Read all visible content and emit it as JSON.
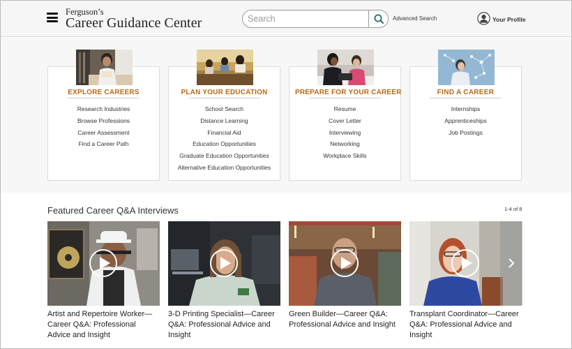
{
  "header": {
    "brand_top": "Ferguson’s",
    "brand_main": "Career Guidance Center",
    "search_placeholder": "Search",
    "advanced_search": "Advanced Search",
    "profile_label": "Your Profile"
  },
  "categories": [
    {
      "title": "EXPLORE CAREERS",
      "links": [
        "Research Industries",
        "Browse Professions",
        "Career Assessment",
        "Find a Career Path"
      ]
    },
    {
      "title": "PLAN YOUR EDUCATION",
      "links": [
        "School Search",
        "Distance Learning",
        "Financial Aid",
        "Education Opportunities",
        "Graduate Education Opportunities",
        "Alternative Education Opportunities"
      ]
    },
    {
      "title": "PREPARE FOR YOUR CAREER",
      "links": [
        "Resume",
        "Cover Letter",
        "Interviewing",
        "Networking",
        "Workplace Skills"
      ]
    },
    {
      "title": "FIND A CAREER",
      "links": [
        "Internships",
        "Apprenticeships",
        "Job Postings"
      ]
    }
  ],
  "featured": {
    "title": "Featured Career Q&A Interviews",
    "count": "1-4 of 8",
    "videos": [
      {
        "caption": "Artist and Repertoire Worker—Career Q&A: Professional Advice and Insight"
      },
      {
        "caption": "3-D Printing Specialist—Career Q&A: Professional Advice and Insight"
      },
      {
        "caption": "Green Builder—Career Q&A: Professional Advice and Insight"
      },
      {
        "caption": "Transplant Coordinator—Career Q&A: Professional Advice and Insight"
      }
    ]
  },
  "colors": {
    "accent_orange": "#b66a1a",
    "search_icon": "#1f6f73",
    "header_bg": "#f6f6f6",
    "section_bg": "#f7f7f7"
  },
  "icons": {
    "menu": "hamburger-icon",
    "search": "search-icon",
    "profile": "user-circle-icon",
    "play": "play-icon",
    "next": "chevron-right-icon"
  }
}
